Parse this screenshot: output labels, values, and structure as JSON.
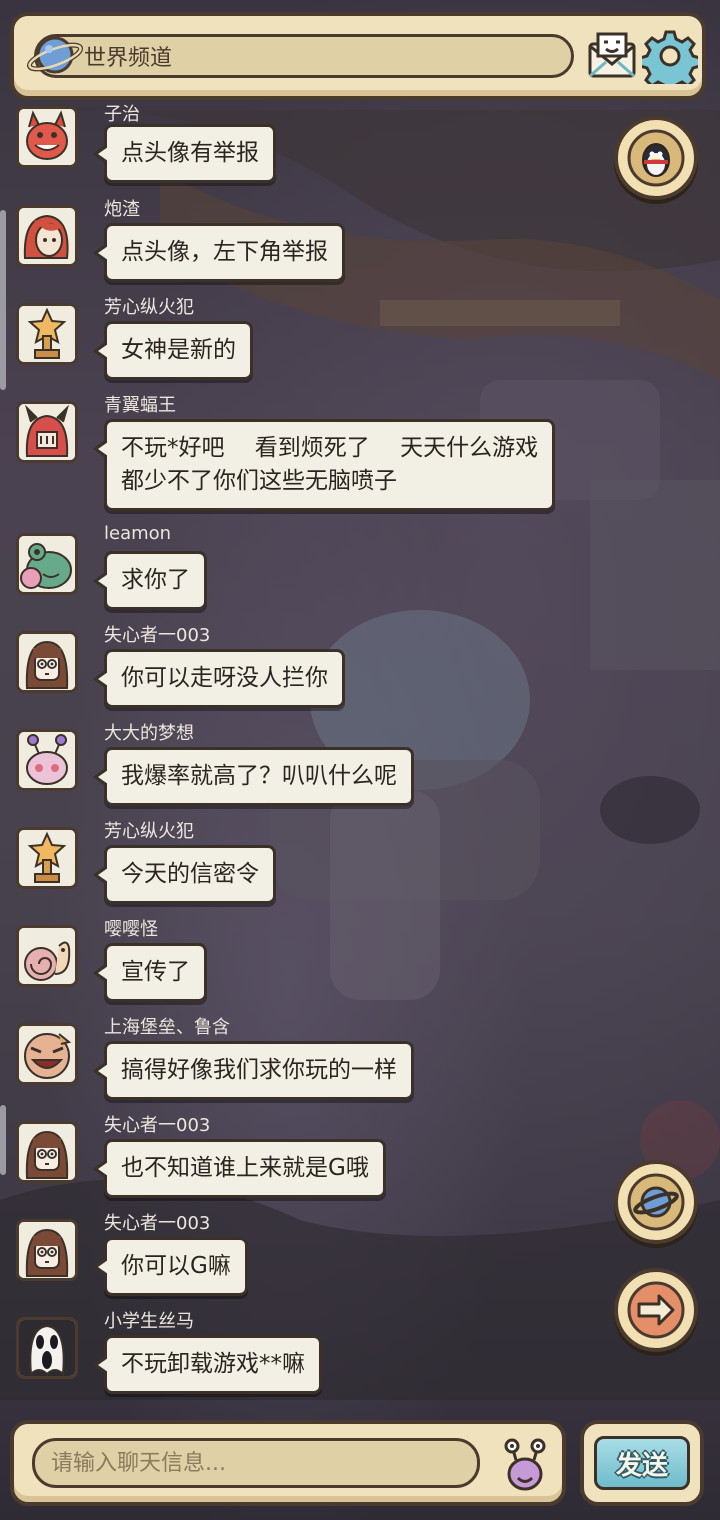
{
  "header": {
    "channel": "世界频道",
    "icons": [
      "planet-icon",
      "mail-icon",
      "gear-icon"
    ]
  },
  "side_buttons": [
    "penguin-icon",
    "planet-icon",
    "arrow-right-icon"
  ],
  "messages": [
    {
      "user": "子治",
      "text": [
        "点头像有举报"
      ],
      "avatar": "red-devil"
    },
    {
      "user": "炮渣",
      "text": [
        "点头像，左下角举报"
      ],
      "avatar": "red-hair"
    },
    {
      "user": "芳心纵火犯",
      "text": [
        "女神是新的"
      ],
      "avatar": "star-statue"
    },
    {
      "user": "青翼蝠王",
      "text": [
        "不玩*好吧　 看到烦死了　 天天什么游戏",
        "都少不了你们这些无脑喷子"
      ],
      "avatar": "red-horned"
    },
    {
      "user": "leamon",
      "text": [
        "求你了"
      ],
      "avatar": "green-frog"
    },
    {
      "user": "失心者一003",
      "text": [
        "你可以走呀没人拦你"
      ],
      "avatar": "brown-girl"
    },
    {
      "user": "大大的梦想",
      "text": [
        "我爆率就高了？叭叭什么呢"
      ],
      "avatar": "snail"
    },
    {
      "user": "芳心纵火犯",
      "text": [
        "今天的信密令"
      ],
      "avatar": "star-statue"
    },
    {
      "user": "嘤嘤怪",
      "text": [
        "宣传了"
      ],
      "avatar": "pink-snail"
    },
    {
      "user": "上海堡垒、鲁含",
      "text": [
        "搞得好像我们求你玩的一样"
      ],
      "avatar": "laughing-face"
    },
    {
      "user": "失心者一003",
      "text": [
        "也不知道谁上来就是G哦"
      ],
      "avatar": "brown-girl"
    },
    {
      "user": "失心者一003",
      "text": [
        "你可以G嘛"
      ],
      "avatar": "brown-girl"
    },
    {
      "user": "小学生丝马",
      "text": [
        "不玩卸载游戏**嘛"
      ],
      "avatar": "ghost-mask"
    }
  ],
  "input": {
    "placeholder": "请输入聊天信息..."
  },
  "send_label": "发送"
}
